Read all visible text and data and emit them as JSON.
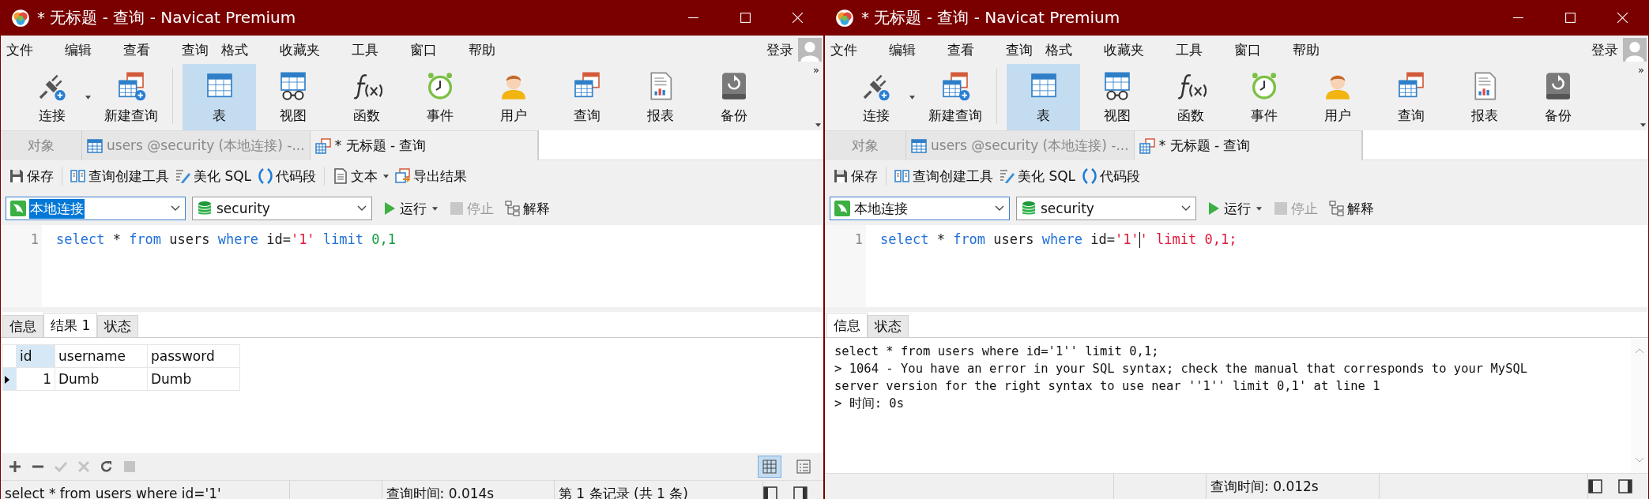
{
  "windows": [
    {
      "title": "* 无标题 - 查询 - Navicat Premium",
      "menu": [
        "文件",
        "编辑",
        "查看",
        "查询",
        "格式",
        "收藏夹",
        "工具",
        "窗口",
        "帮助"
      ],
      "login": "登录",
      "more": "»",
      "toolbar": [
        {
          "kind": "connection",
          "label": "连接",
          "selected": false
        },
        {
          "kind": "new-query",
          "label": "新建查询",
          "selected": false
        },
        {
          "kind": "table",
          "label": "表",
          "selected": true
        },
        {
          "kind": "view",
          "label": "视图",
          "selected": false
        },
        {
          "kind": "function",
          "label": "函数",
          "selected": false
        },
        {
          "kind": "event",
          "label": "事件",
          "selected": false
        },
        {
          "kind": "user",
          "label": "用户",
          "selected": false
        },
        {
          "kind": "query",
          "label": "查询",
          "selected": false
        },
        {
          "kind": "report",
          "label": "报表",
          "selected": false
        },
        {
          "kind": "backup",
          "label": "备份",
          "selected": false
        }
      ],
      "doc_tabs": [
        {
          "kind": "objects",
          "label": "对象",
          "selected": false
        },
        {
          "kind": "table",
          "label": "users @security (本地连接) -...",
          "selected": false
        },
        {
          "kind": "query",
          "label": "* 无标题 - 查询",
          "selected": true
        }
      ],
      "query_toolbar": [
        {
          "kind": "save",
          "label": "保存"
        },
        {
          "kind": "builder",
          "label": "查询创建工具"
        },
        {
          "kind": "beautify",
          "label": "美化 SQL"
        },
        {
          "kind": "snippet",
          "label": "代码段"
        },
        {
          "kind": "text",
          "label": "文本"
        },
        {
          "kind": "export",
          "label": "导出结果"
        }
      ],
      "connection": {
        "value": "本地连接",
        "selected": true
      },
      "database": {
        "value": "security"
      },
      "run_controls": [
        {
          "kind": "run",
          "label": "运行",
          "disabled": false
        },
        {
          "kind": "stop",
          "label": "停止",
          "disabled": true
        },
        {
          "kind": "explain",
          "label": "解释",
          "disabled": false
        }
      ],
      "editor": {
        "line_number": "1",
        "tokens": [
          {
            "kind": "keyword",
            "text": "select"
          },
          {
            "kind": "plain",
            "text": " * "
          },
          {
            "kind": "keyword",
            "text": "from"
          },
          {
            "kind": "plain",
            "text": " users "
          },
          {
            "kind": "keyword",
            "text": "where"
          },
          {
            "kind": "plain",
            "text": " id="
          },
          {
            "kind": "string",
            "text": "'1'"
          },
          {
            "kind": "keyword",
            "text": " limit "
          },
          {
            "kind": "number",
            "text": "0,1"
          }
        ]
      },
      "result_tabs": [
        {
          "label": "信息",
          "selected": false
        },
        {
          "label": "结果 1",
          "selected": true
        },
        {
          "label": "状态",
          "selected": false
        }
      ],
      "result": {
        "kind": "grid",
        "columns": [
          {
            "label": "id",
            "selected": true
          },
          {
            "label": "username",
            "selected": false
          },
          {
            "label": "password",
            "selected": false
          }
        ],
        "rows": [
          {
            "current": true,
            "cells": [
              "1",
              "Dumb",
              "Dumb"
            ]
          }
        ],
        "actions": [
          {
            "kind": "add",
            "disabled": false
          },
          {
            "kind": "remove",
            "disabled": false
          },
          {
            "kind": "apply",
            "disabled": true
          },
          {
            "kind": "cancel",
            "disabled": true
          },
          {
            "kind": "refresh",
            "disabled": false
          },
          {
            "kind": "stop",
            "disabled": true
          }
        ],
        "view_modes": [
          {
            "kind": "grid",
            "selected": true
          },
          {
            "kind": "form",
            "selected": false
          }
        ]
      },
      "status": [
        {
          "kind": "sql",
          "text": "select * from users where id='1'"
        },
        {
          "kind": "time",
          "text": "查询时间: 0.014s"
        },
        {
          "kind": "records",
          "text": "第 1 条记录 (共 1 条)"
        }
      ]
    },
    {
      "title": "* 无标题 - 查询 - Navicat Premium",
      "menu": [
        "文件",
        "编辑",
        "查看",
        "查询",
        "格式",
        "收藏夹",
        "工具",
        "窗口",
        "帮助"
      ],
      "login": "登录",
      "more": "»",
      "toolbar": [
        {
          "kind": "connection",
          "label": "连接",
          "selected": false
        },
        {
          "kind": "new-query",
          "label": "新建查询",
          "selected": false
        },
        {
          "kind": "table",
          "label": "表",
          "selected": true
        },
        {
          "kind": "view",
          "label": "视图",
          "selected": false
        },
        {
          "kind": "function",
          "label": "函数",
          "selected": false
        },
        {
          "kind": "event",
          "label": "事件",
          "selected": false
        },
        {
          "kind": "user",
          "label": "用户",
          "selected": false
        },
        {
          "kind": "query",
          "label": "查询",
          "selected": false
        },
        {
          "kind": "report",
          "label": "报表",
          "selected": false
        },
        {
          "kind": "backup",
          "label": "备份",
          "selected": false
        }
      ],
      "doc_tabs": [
        {
          "kind": "objects",
          "label": "对象",
          "selected": false
        },
        {
          "kind": "table",
          "label": "users @security (本地连接) -...",
          "selected": false
        },
        {
          "kind": "query",
          "label": "* 无标题 - 查询",
          "selected": true
        }
      ],
      "query_toolbar": [
        {
          "kind": "save",
          "label": "保存"
        },
        {
          "kind": "builder",
          "label": "查询创建工具"
        },
        {
          "kind": "beautify",
          "label": "美化 SQL"
        },
        {
          "kind": "snippet",
          "label": "代码段"
        }
      ],
      "connection": {
        "value": "本地连接",
        "selected": false
      },
      "database": {
        "value": "security"
      },
      "run_controls": [
        {
          "kind": "run",
          "label": "运行",
          "disabled": false
        },
        {
          "kind": "stop",
          "label": "停止",
          "disabled": true
        },
        {
          "kind": "explain",
          "label": "解释",
          "disabled": false
        }
      ],
      "editor": {
        "line_number": "1",
        "tokens": [
          {
            "kind": "keyword",
            "text": "select",
            "cursor": false
          },
          {
            "kind": "plain",
            "text": " * ",
            "cursor": false
          },
          {
            "kind": "keyword",
            "text": "from",
            "cursor": false
          },
          {
            "kind": "plain",
            "text": " users ",
            "cursor": false
          },
          {
            "kind": "keyword",
            "text": "where",
            "cursor": false
          },
          {
            "kind": "plain",
            "text": " id=",
            "cursor": false
          },
          {
            "kind": "string",
            "text": "'1'",
            "cursor": true
          },
          {
            "kind": "string",
            "text": "' limit 0,1;",
            "cursor": false
          }
        ]
      },
      "result_tabs": [
        {
          "label": "信息",
          "selected": true
        },
        {
          "label": "状态",
          "selected": false
        }
      ],
      "result": {
        "kind": "messages",
        "lines": [
          "select * from users where id='1'' limit 0,1;",
          "> 1064 - You have an error in your SQL syntax; check the manual that corresponds to your MySQL",
          "server version for the right syntax to use near ''1'' limit 0,1' at line 1",
          "> 时间: 0s"
        ]
      },
      "status": [
        {
          "kind": "time",
          "text": "查询时间: 0.012s"
        }
      ]
    }
  ]
}
